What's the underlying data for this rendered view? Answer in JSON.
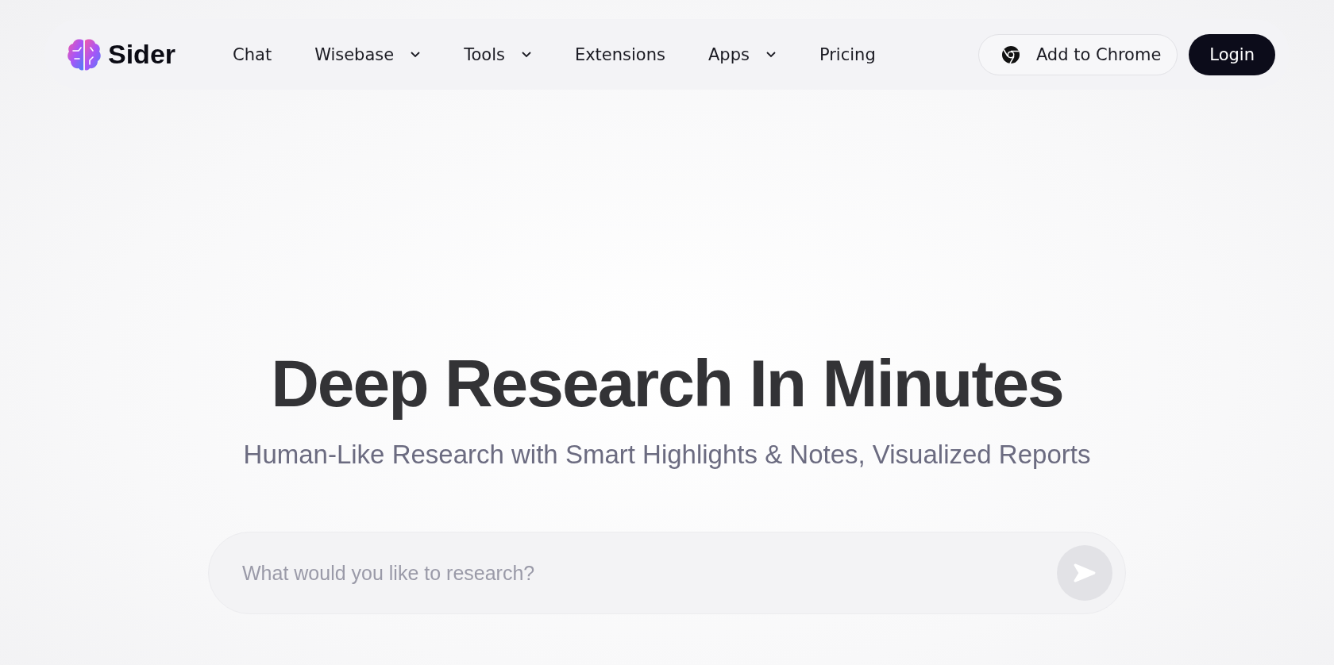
{
  "logo": {
    "text": "Sider"
  },
  "nav": [
    {
      "label": "Chat",
      "has_menu": false
    },
    {
      "label": "Wisebase",
      "has_menu": true
    },
    {
      "label": "Tools",
      "has_menu": true
    },
    {
      "label": "Extensions",
      "has_menu": false
    },
    {
      "label": "Apps",
      "has_menu": true
    },
    {
      "label": "Pricing",
      "has_menu": false
    }
  ],
  "actions": {
    "chrome_button": "Add to Chrome",
    "login_button": "Login"
  },
  "hero": {
    "title": "Deep Research In Minutes",
    "subtitle": "Human-Like Research with Smart Highlights & Notes, Visualized Reports"
  },
  "search": {
    "placeholder": "What would you like to research?"
  }
}
